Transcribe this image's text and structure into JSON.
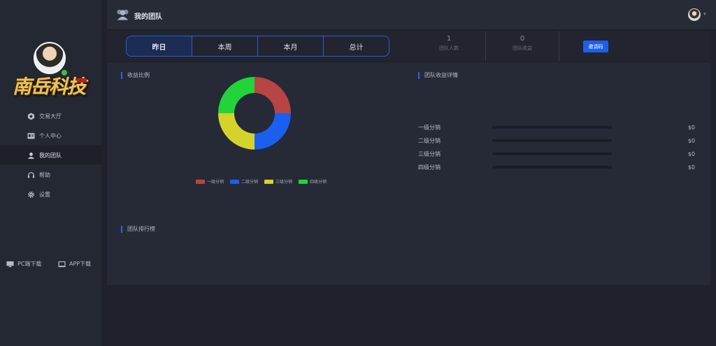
{
  "sidebar": {
    "brand": "南岳科技",
    "nav": [
      {
        "label": "交易大厅",
        "icon": "hex-icon",
        "active": false
      },
      {
        "label": "个人中心",
        "icon": "id-card-icon",
        "active": false
      },
      {
        "label": "我的团队",
        "icon": "team-icon",
        "active": true
      },
      {
        "label": "帮助",
        "icon": "headset-icon",
        "active": false
      },
      {
        "label": "设置",
        "icon": "gear-icon",
        "active": false
      }
    ],
    "downloads": [
      {
        "label": "PC端下载",
        "icon": "monitor-icon"
      },
      {
        "label": "APP下载",
        "icon": "tablet-icon"
      }
    ]
  },
  "header": {
    "title": "我的团队"
  },
  "tabs": [
    {
      "label": "昨日",
      "active": true
    },
    {
      "label": "本周",
      "active": false
    },
    {
      "label": "本月",
      "active": false
    },
    {
      "label": "总计",
      "active": false
    }
  ],
  "stats": [
    {
      "value": "1",
      "label": "团队人数"
    },
    {
      "value": "0",
      "label": "团队收益"
    }
  ],
  "invite_label": "邀请码",
  "sections": {
    "ratio": "收益比例",
    "detail": "团队收益详情",
    "ranking": "团队排行榜"
  },
  "chart_data": {
    "type": "pie",
    "title": "收益比例",
    "categories": [
      "一级分销",
      "二级分销",
      "三级分销",
      "四级分销"
    ],
    "values": [
      25,
      25,
      25,
      25
    ],
    "colors": [
      "#b84444",
      "#1a5ff0",
      "#d3d32c",
      "#22d43a"
    ],
    "legend": "bottom"
  },
  "details": [
    {
      "label": "一级分销",
      "amount": "$0",
      "fill": 0
    },
    {
      "label": "二级分销",
      "amount": "$0",
      "fill": 0
    },
    {
      "label": "三级分销",
      "amount": "$0",
      "fill": 0
    },
    {
      "label": "四级分销",
      "amount": "$0",
      "fill": 0
    }
  ]
}
